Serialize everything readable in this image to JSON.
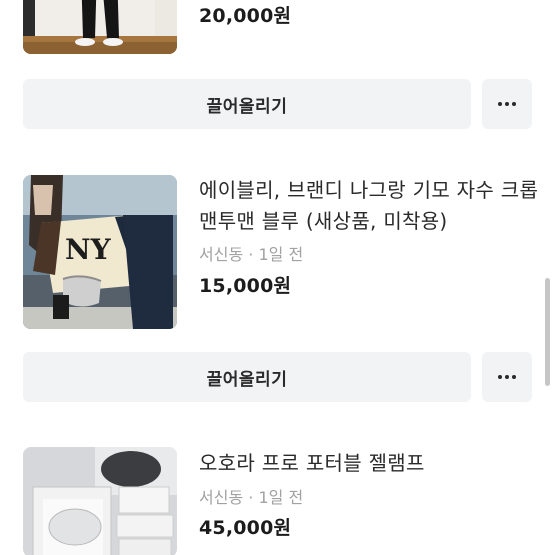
{
  "listings": [
    {
      "price": "20,000원",
      "thumb_desc": "black-pants-photo"
    },
    {
      "title": "에이블리, 브랜디 나그랑 기모 자수 크롭 맨투맨 블루 (새상품, 미착용)",
      "location": "서신동",
      "separator": "·",
      "time": "1일 전",
      "price": "15,000원",
      "thumb_desc": "sweatshirt-photo"
    },
    {
      "title": "오호라 프로 포터블 젤램프",
      "location": "서신동",
      "separator": "·",
      "time": "1일 전",
      "price": "45,000원",
      "thumb_desc": "gel-lamp-photo"
    }
  ],
  "actions": {
    "bump_label": "끌어올리기",
    "more_icon": "more-horizontal-icon"
  },
  "colors": {
    "button_bg": "#f2f3f5",
    "text_primary": "#1c1c1c",
    "text_secondary": "#a2a2a2"
  }
}
